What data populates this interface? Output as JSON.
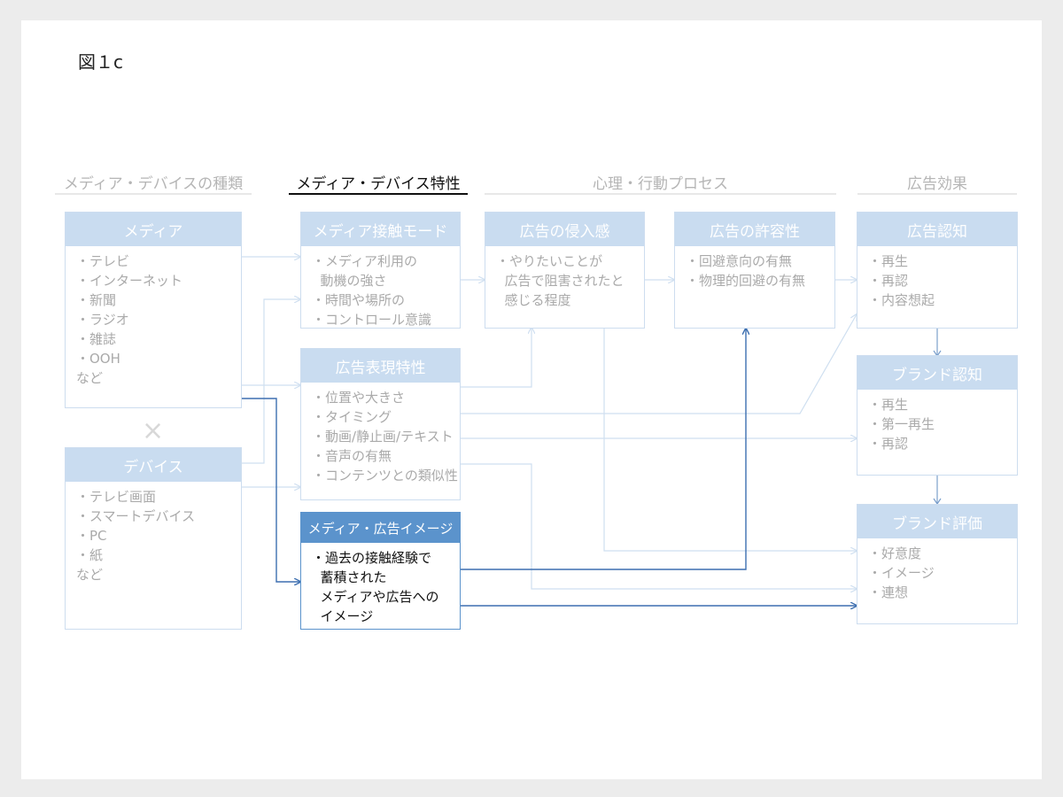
{
  "figure_label": "図１c",
  "headings": {
    "types": "メディア・デバイスの種類",
    "characteristics": "メディア・デバイス特性",
    "process": "心理・行動プロセス",
    "effects": "広告効果"
  },
  "cross_symbol": "×",
  "boxes": {
    "media": {
      "title": "メディア",
      "items": [
        "・テレビ",
        "・インターネット",
        "・新聞",
        "・ラジオ",
        "・雑誌",
        "・OOH",
        "など"
      ]
    },
    "device": {
      "title": "デバイス",
      "items": [
        "・テレビ画面",
        "・スマートデバイス",
        "・PC",
        "・紙",
        "など"
      ]
    },
    "contact_mode": {
      "title": "メディア接触モード",
      "items": [
        "・メディア利用の",
        "  動機の強さ",
        "・時間や場所の",
        "・コントロール意識"
      ]
    },
    "ad_expression": {
      "title": "広告表現特性",
      "items": [
        "・位置や大きさ",
        "・タイミング",
        "・動画/静止画/テキスト",
        "・音声の有無",
        "・コンテンツとの類似性"
      ]
    },
    "media_ad_image": {
      "title": "メディア・広告イメージ",
      "items": [
        "・過去の接触経験で",
        "  蓄積された",
        "  メディアや広告への",
        "  イメージ"
      ]
    },
    "intrusiveness": {
      "title": "広告の侵入感",
      "items": [
        "・やりたいことが",
        "  広告で阻害されたと",
        "  感じる程度"
      ]
    },
    "acceptability": {
      "title": "広告の許容性",
      "items": [
        "・回避意向の有無",
        "・物理的回避の有無"
      ]
    },
    "ad_recognition": {
      "title": "広告認知",
      "items": [
        "・再生",
        "・再認",
        "・内容想起"
      ]
    },
    "brand_recognition": {
      "title": "ブランド認知",
      "items": [
        "・再生",
        "・第一再生",
        "・再認"
      ]
    },
    "brand_evaluation": {
      "title": "ブランド評価",
      "items": [
        "・好意度",
        "・イメージ",
        "・連想"
      ]
    }
  },
  "colors": {
    "faded_box_title": "#c9dcf0",
    "highlight": "#5b93cc",
    "faded_arrow": "#cfdff0",
    "strong_arrow": "#3d6fb0"
  }
}
